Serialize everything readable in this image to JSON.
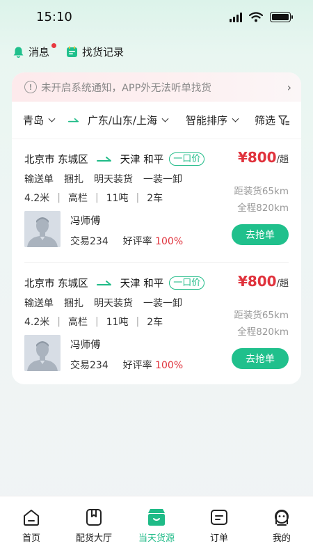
{
  "status": {
    "time": "15:10"
  },
  "topnav": {
    "messages": "消息",
    "history": "找货记录"
  },
  "notice": {
    "text": "未开启系统通知，APP外无法听单找货"
  },
  "filters": {
    "origin": "青岛",
    "destination": "广东/山东/上海",
    "sort": "智能排序",
    "filter": "筛选"
  },
  "orders": [
    {
      "from": "北京市 东城区",
      "to": "天津 和平",
      "tag": "一口价",
      "price": "¥800",
      "price_unit": "/趟",
      "tags": [
        "输送单",
        "捆扎",
        "明天装货",
        "一装一卸"
      ],
      "specs": [
        "4.2米",
        "高栏",
        "11吨",
        "2车"
      ],
      "distance_to_load": "距装货65km",
      "total_distance": "全程820km",
      "driver": "冯师傅",
      "trades": "交易234",
      "rating_label": "好评率",
      "rating": "100%",
      "button": "去抢单"
    },
    {
      "from": "北京市 东城区",
      "to": "天津 和平",
      "tag": "一口价",
      "price": "¥800",
      "price_unit": "/趟",
      "tags": [
        "输送单",
        "捆扎",
        "明天装货",
        "一装一卸"
      ],
      "specs": [
        "4.2米",
        "高栏",
        "11吨",
        "2车"
      ],
      "distance_to_load": "距装货65km",
      "total_distance": "全程820km",
      "driver": "冯师傅",
      "trades": "交易234",
      "rating_label": "好评率",
      "rating": "100%",
      "button": "去抢单"
    }
  ],
  "tabs": [
    {
      "label": "首页",
      "icon": "home-icon"
    },
    {
      "label": "配货大厅",
      "icon": "bookmark-icon"
    },
    {
      "label": "当天货源",
      "icon": "box-icon",
      "active": true
    },
    {
      "label": "订单",
      "icon": "order-icon"
    },
    {
      "label": "我的",
      "icon": "profile-icon"
    }
  ],
  "colors": {
    "accent": "#1fbb87",
    "price": "#e0333d"
  }
}
